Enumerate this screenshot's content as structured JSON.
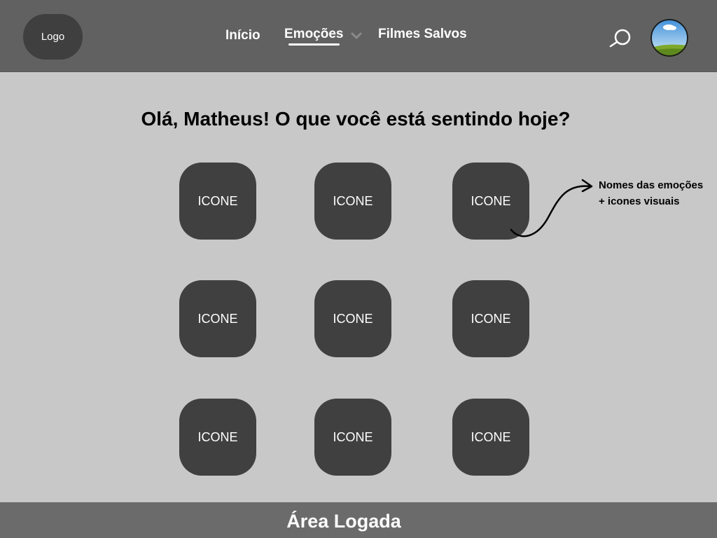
{
  "header": {
    "logo_label": "Logo",
    "nav": {
      "inicio": "Início",
      "emocoes": "Emoções",
      "filmes_salvos": "Filmes Salvos"
    }
  },
  "main": {
    "greeting": "Olá, Matheus! O que você está sentindo hoje?",
    "tiles": [
      "ICONE",
      "ICONE",
      "ICONE",
      "ICONE",
      "ICONE",
      "ICONE",
      "ICONE",
      "ICONE",
      "ICONE"
    ],
    "annotation": "Nomes das emoções + icones visuais"
  },
  "footer": {
    "title": "Área Logada"
  },
  "colors": {
    "header_bg": "#616161",
    "page_bg": "#c8c8c8",
    "tile_bg": "#404040",
    "footer_bg": "#6b6b6b"
  }
}
